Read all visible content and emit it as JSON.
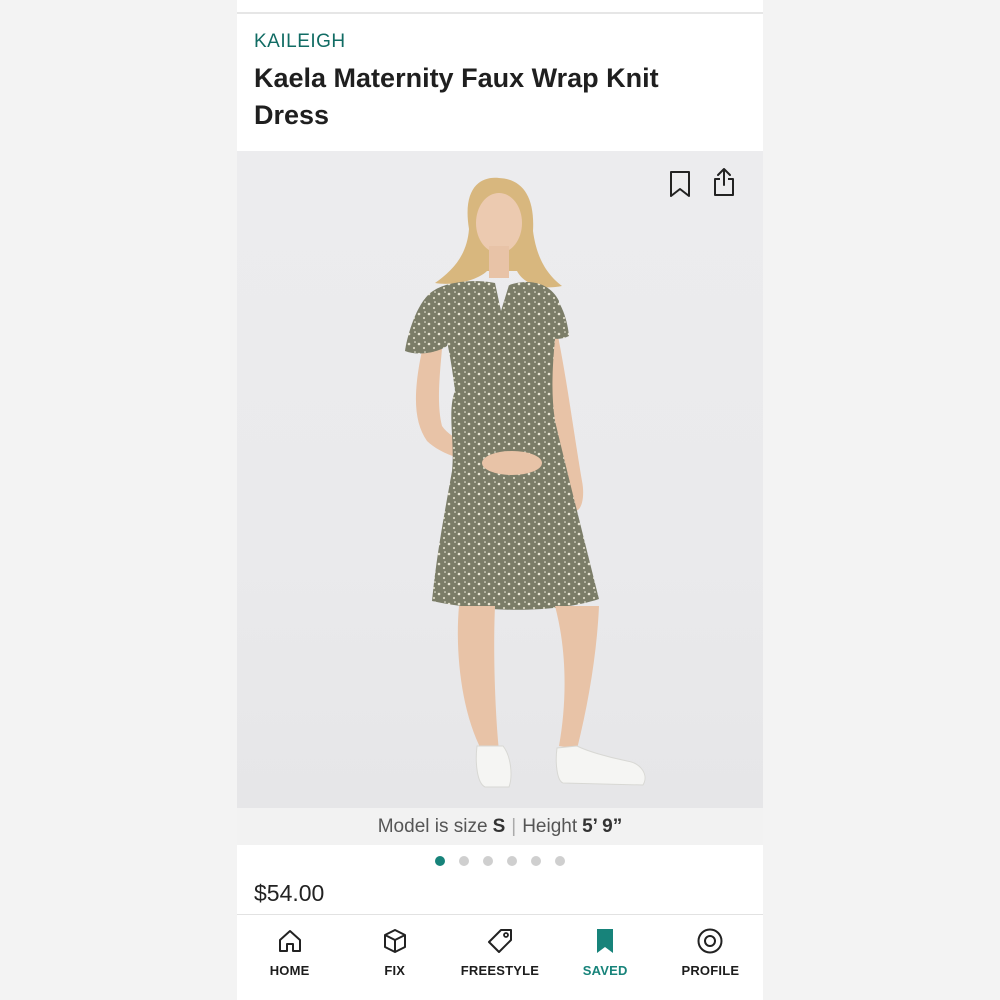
{
  "product": {
    "brand": "KAILEIGH",
    "title": "Kaela Maternity Faux Wrap Knit Dress",
    "price": "$54.00"
  },
  "photo": {
    "caption_prefix": "Model is size",
    "model_size": "S",
    "caption_separator": "|",
    "height_label": "Height",
    "model_height": "5’ 9”",
    "total_images": 6,
    "active_image": 1
  },
  "icons": {
    "bookmark": "bookmark-outline-icon",
    "share": "share-icon"
  },
  "nav": {
    "items": [
      {
        "label": "HOME",
        "icon": "house-icon",
        "active": false
      },
      {
        "label": "FIX",
        "icon": "box-icon",
        "active": false
      },
      {
        "label": "FREESTYLE",
        "icon": "tag-icon",
        "active": false
      },
      {
        "label": "SAVED",
        "icon": "bookmark-filled-icon",
        "active": true
      },
      {
        "label": "PROFILE",
        "icon": "profile-circle-icon",
        "active": false
      }
    ]
  },
  "colors": {
    "accent": "#17837a",
    "brand_text": "#116c64",
    "dress": "#7d7f6a"
  }
}
